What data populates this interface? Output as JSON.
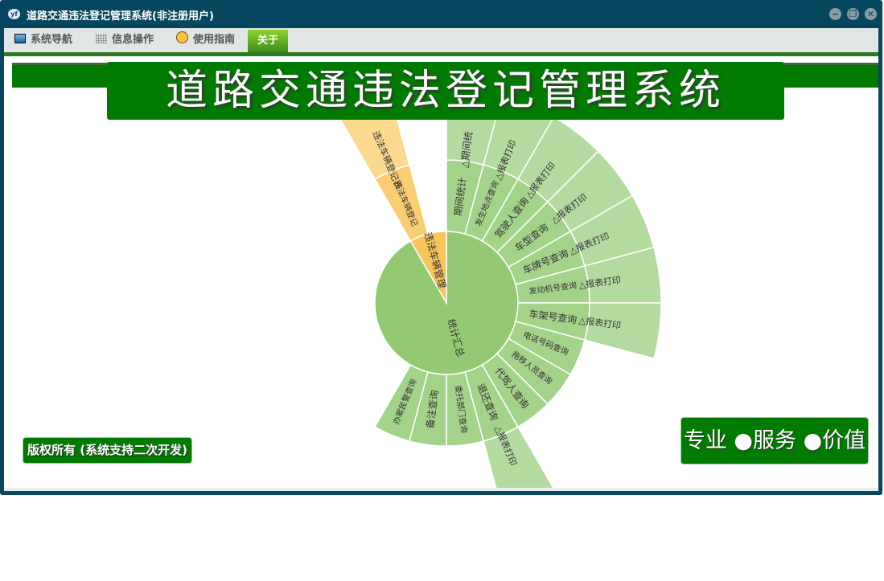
{
  "window": {
    "title": "道路交通违法登记管理系统(非注册用户)",
    "controls": {
      "minimize": "−",
      "restore": "❐",
      "close": "✕"
    }
  },
  "menu": {
    "items": [
      {
        "label": "系统导航",
        "icon": "monitor-icon"
      },
      {
        "label": "信息操作",
        "icon": "grid-icon"
      },
      {
        "label": "使用指南",
        "icon": "help-icon"
      },
      {
        "label": "关于",
        "icon": null,
        "active": true
      }
    ]
  },
  "header": {
    "title": "道路交通违法登记管理系统"
  },
  "footer": {
    "copyright": "版权所有 (系统支持二次开发)",
    "slogan": "专业 ●服务 ●价值"
  },
  "colors": {
    "brand_green": "#007a00",
    "title_bar": "#06475f"
  },
  "chart_data": {
    "type": "sunburst",
    "root": [
      {
        "label": "统计汇总",
        "value": 22,
        "color": "#93c972",
        "child_color": "#a3d289",
        "leaf_color": "#b3dba0",
        "children": [
          {
            "label": "期间统计",
            "children": [
              {
                "label": "△期间统"
              }
            ]
          },
          {
            "label": "发生地点查询",
            "children": [
              {
                "label": "△报表打印"
              }
            ]
          },
          {
            "label": "驾驶人查询",
            "children": [
              {
                "label": "△报表打印"
              }
            ]
          },
          {
            "label": "车型查询",
            "children": [
              {
                "label": "△报表打印"
              }
            ]
          },
          {
            "label": "车牌号查询",
            "children": [
              {
                "label": "△报表打印"
              }
            ]
          },
          {
            "label": "发动机号查询",
            "children": [
              {
                "label": "△报表打印"
              }
            ]
          },
          {
            "label": "车架号查询",
            "children": [
              {
                "label": "△报表打印"
              }
            ]
          },
          {
            "label": "电话号码查询"
          },
          {
            "label": "拖移人员查询"
          },
          {
            "label": "代驾人查询"
          },
          {
            "label": "退还查询",
            "children": [
              {
                "label": "△报表打印"
              }
            ]
          },
          {
            "label": "委托部门查询"
          },
          {
            "label": "备注查询"
          },
          {
            "label": "办案民警查询"
          }
        ]
      },
      {
        "label": "违法车辆管理",
        "value": 2,
        "color": "#f8c45c",
        "child_color": "#f9cd72",
        "leaf_color": "#fbd98f",
        "children": [
          {
            "label": "违法车辆登记",
            "children": [
              {
                "label": "违法车辆登记表"
              }
            ]
          }
        ]
      }
    ]
  }
}
